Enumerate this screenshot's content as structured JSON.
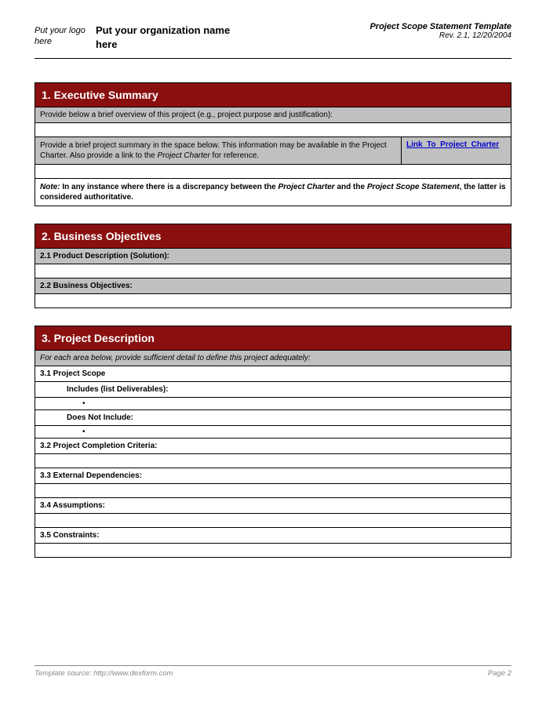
{
  "header": {
    "logo_placeholder": "Put your logo here",
    "org_placeholder": "Put your organization name here",
    "doc_title": "Project Scope Statement Template",
    "revision": "Rev. 2.1, 12/20/2004"
  },
  "sections": {
    "s1": {
      "title": "1.  Executive Summary",
      "row1": "Provide below a brief overview of this project (e.g., project purpose and justification):",
      "row2_left_a": "Provide a brief project summary in the space below.  This information may be available in the Project Charter.  Also provide a link to the ",
      "row2_left_b": "Project Charter",
      "row2_left_c": " for reference.",
      "row2_link": "Link_To_Project_Charter",
      "note_prefix": "Note:",
      "note_a": "  In any instance where there is a discrepancy between the ",
      "note_b": "Project Charter",
      "note_c": " and the ",
      "note_d": "Project Scope Statement",
      "note_e": ", the latter is considered authoritative."
    },
    "s2": {
      "title": "2.  Business Objectives",
      "r1": "2.1  Product Description (Solution):",
      "r2": "2.2  Business Objectives:"
    },
    "s3": {
      "title": "3.  Project Description",
      "intro": "For each area below, provide sufficient detail to define this project adequately:",
      "r31": "3.1  Project Scope",
      "r31a": "Includes (list Deliverables):",
      "bullet": "•",
      "r31b": "Does Not Include:",
      "r32": "3.2  Project Completion Criteria:",
      "r33": "3.3  External Dependencies:",
      "r34": "3.4  Assumptions:",
      "r35": "3.5  Constraints:"
    }
  },
  "footer": {
    "source": "Template source: http://www.dexform.com",
    "page": "Page 2"
  }
}
